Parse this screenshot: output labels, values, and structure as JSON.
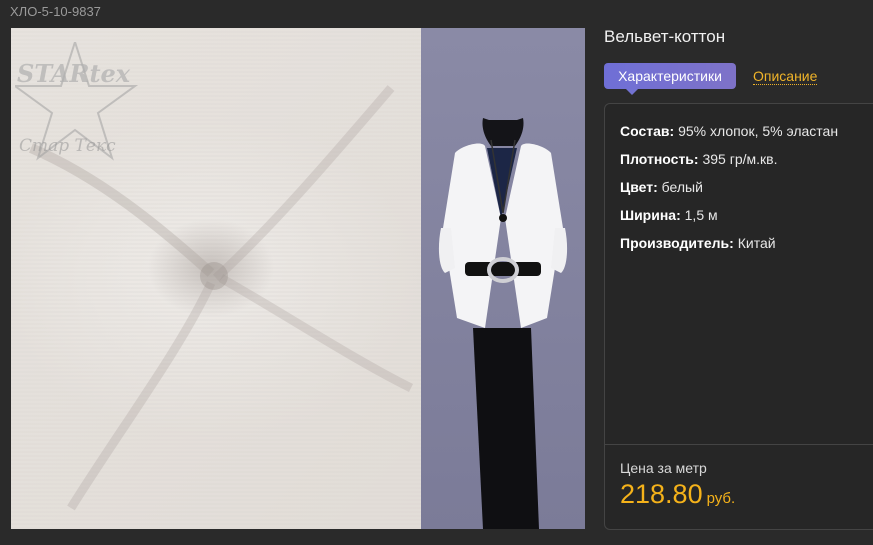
{
  "product": {
    "sku": "ХЛО-5-10-9837",
    "title": "Вельвет-коттон"
  },
  "watermark": {
    "logo": "STARtex",
    "text": "Стар Текс"
  },
  "tabs": {
    "active_label": "Характеристики",
    "link_label": "Описание"
  },
  "specs": [
    {
      "label": "Состав:",
      "value": "95% хлопок, 5% эластан"
    },
    {
      "label": "Плотность:",
      "value": "395 гр/м.кв."
    },
    {
      "label": "Цвет:",
      "value": "белый"
    },
    {
      "label": "Ширина:",
      "value": "1,5 м"
    },
    {
      "label": "Производитель:",
      "value": "Китай"
    }
  ],
  "price": {
    "label": "Цена за метр",
    "value": "218.80",
    "currency": "руб."
  },
  "colors": {
    "accent": "#f5b21a",
    "tab_active": "#7272d2",
    "background": "#2a2a2a"
  }
}
